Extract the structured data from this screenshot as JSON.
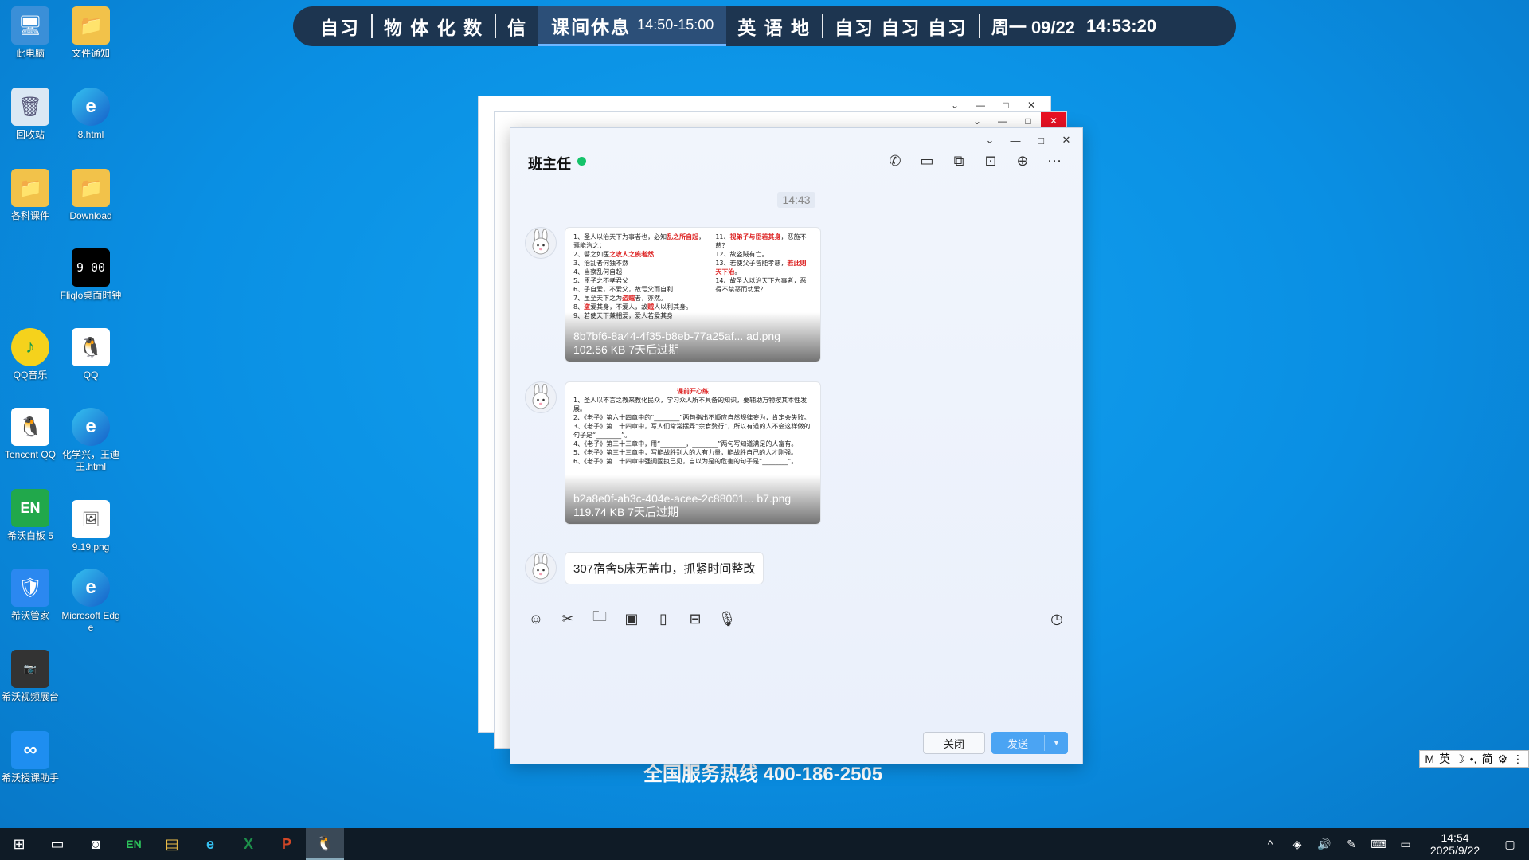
{
  "desktop": {
    "icons_col1": [
      {
        "name": "this-pc",
        "label": "此电脑",
        "glyph": "🖥"
      },
      {
        "name": "recycle-bin",
        "label": "回收站",
        "glyph": "🗑"
      },
      {
        "name": "courseware",
        "label": "各科课件",
        "glyph": "📁"
      },
      {
        "name": "qq-music",
        "label": "QQ音乐",
        "glyph": "♪"
      },
      {
        "name": "tencent-qq",
        "label": "Tencent QQ",
        "glyph": "🐧"
      },
      {
        "name": "whiteboard",
        "label": "希沃白板 5",
        "glyph": "EN"
      },
      {
        "name": "seewo-manager",
        "label": "希沃管家",
        "glyph": "🛡"
      },
      {
        "name": "seewo-camera",
        "label": "希沃视频展台",
        "glyph": "📷"
      },
      {
        "name": "seewo-link",
        "label": "希沃授课助手",
        "glyph": "∞"
      }
    ],
    "icons_col2": [
      {
        "name": "file-notice",
        "label": "文件通知",
        "glyph": "📁"
      },
      {
        "name": "edge-8-html",
        "label": "8.html",
        "glyph": "e"
      },
      {
        "name": "download-folder",
        "label": "Download",
        "glyph": "📁"
      },
      {
        "name": "fliqlo",
        "label": "Fliqlo桌面时钟",
        "glyph": "9 00"
      },
      {
        "name": "qq",
        "label": "QQ",
        "glyph": "🐧"
      },
      {
        "name": "chem-html",
        "label": "化学兴，王迪王.html",
        "glyph": "e"
      },
      {
        "name": "png-9-19",
        "label": "9.19.png",
        "glyph": "🖼"
      },
      {
        "name": "microsoft-edge",
        "label": "Microsoft Edge",
        "glyph": "e"
      }
    ],
    "hotline": "全国服务热线 400-186-2505"
  },
  "schedule_bar": {
    "seg1": "自习",
    "seg2": "物 体 化 数",
    "seg3": "信",
    "current_label": "课间休息",
    "current_time": "14:50-15:00",
    "seg4": "英 语 地",
    "seg5": "自习  自习  自习",
    "day": "周一 09/22",
    "clock": "14:53:20"
  },
  "chat": {
    "title": "班主任",
    "timestamp": "14:43",
    "messages": [
      {
        "file_name": "8b7bf6-8a44-4f35-b8eb-77a25af... ad.png",
        "file_meta": "102.56 KB 7天后过期"
      },
      {
        "file_name": "b2a8e0f-ab3c-404e-acee-2c88001... b7.png",
        "file_meta": "119.74 KB 7天后过期",
        "doc_title": "课前开心练"
      },
      {
        "text": "307宿舍5床无盖巾，抓紧时间整改"
      }
    ],
    "close_label": "关闭",
    "send_label": "发送"
  },
  "ime": {
    "mode": "英",
    "simp": "简"
  },
  "taskbar": {
    "time": "14:54",
    "date": "2025/9/22"
  },
  "colors": {
    "desktop_bg": "#0a8fe3",
    "topbar_bg": "#1d3550",
    "online": "#15c36a",
    "send_button": "#4ba4f3"
  }
}
